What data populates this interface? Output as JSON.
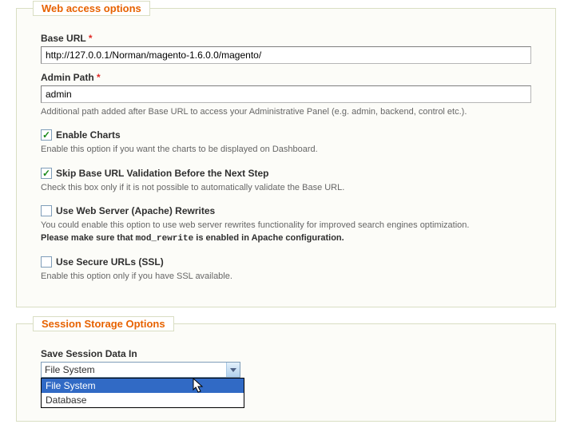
{
  "webAccess": {
    "legend": "Web access options",
    "baseUrl": {
      "label": "Base URL",
      "required": "*",
      "value": "http://127.0.0.1/Norman/magento-1.6.0.0/magento/"
    },
    "adminPath": {
      "label": "Admin Path",
      "required": "*",
      "value": "admin",
      "hint": "Additional path added after Base URL to access your Administrative Panel (e.g. admin, backend, control etc.)."
    },
    "enableCharts": {
      "label": "Enable Charts",
      "hint": "Enable this option if you want the charts to be displayed on Dashboard."
    },
    "skipValidation": {
      "label": "Skip Base URL Validation Before the Next Step",
      "hint": "Check this box only if it is not possible to automatically validate the Base URL."
    },
    "rewrites": {
      "label": "Use Web Server (Apache) Rewrites",
      "hintPre": "You could enable this option to use web server rewrites functionality for improved search engines optimization.",
      "hintBold1": "Please make sure that ",
      "hintCode": "mod_rewrite",
      "hintBold2": " is enabled in Apache configuration."
    },
    "ssl": {
      "label": "Use Secure URLs (SSL)",
      "hint": "Enable this option only if you have SSL available."
    }
  },
  "sessionStorage": {
    "legend": "Session Storage Options",
    "saveIn": {
      "label": "Save Session Data In",
      "selected": "File System",
      "options": {
        "fileSystem": "File System",
        "database": "Database"
      }
    }
  }
}
